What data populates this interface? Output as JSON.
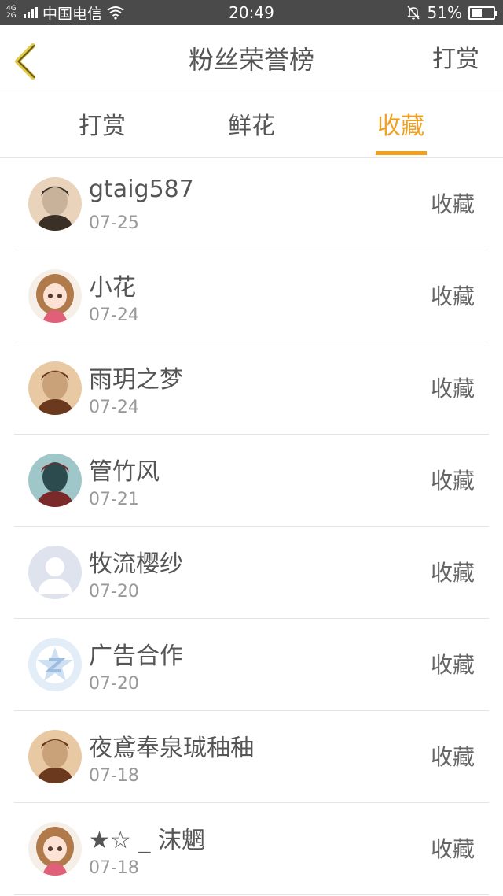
{
  "status_bar": {
    "network": [
      "4G",
      "2G"
    ],
    "carrier": "中国电信",
    "time": "20:49",
    "battery": "51%",
    "battery_level": 0.51
  },
  "header": {
    "title": "粉丝荣誉榜",
    "action_label": "打赏"
  },
  "tabs": [
    {
      "label": "打赏",
      "active": false
    },
    {
      "label": "鲜花",
      "active": false
    },
    {
      "label": "收藏",
      "active": true
    }
  ],
  "accent_color": "#f0a020",
  "fans": [
    {
      "name": "gtaig587",
      "date": "07-25",
      "type": "收藏",
      "avatar": "photo-avatar"
    },
    {
      "name": "小花",
      "date": "07-24",
      "type": "收藏",
      "avatar": "anime-girl-avatar"
    },
    {
      "name": "雨玥之梦",
      "date": "07-24",
      "type": "收藏",
      "avatar": "photo-avatar"
    },
    {
      "name": "管竹风",
      "date": "07-21",
      "type": "收藏",
      "avatar": "photo-avatar"
    },
    {
      "name": "牧流樱纱",
      "date": "07-20",
      "type": "收藏",
      "avatar": "default-avatar"
    },
    {
      "name": "广告合作",
      "date": "07-20",
      "type": "收藏",
      "avatar": "star-logo-avatar"
    },
    {
      "name": "夜鳶奉泉珹秞秞",
      "date": "07-18",
      "type": "收藏",
      "avatar": "photo-avatar"
    },
    {
      "name": "★☆ _ 沫魍",
      "date": "07-18",
      "type": "收藏",
      "avatar": "anime-girl-avatar"
    }
  ]
}
